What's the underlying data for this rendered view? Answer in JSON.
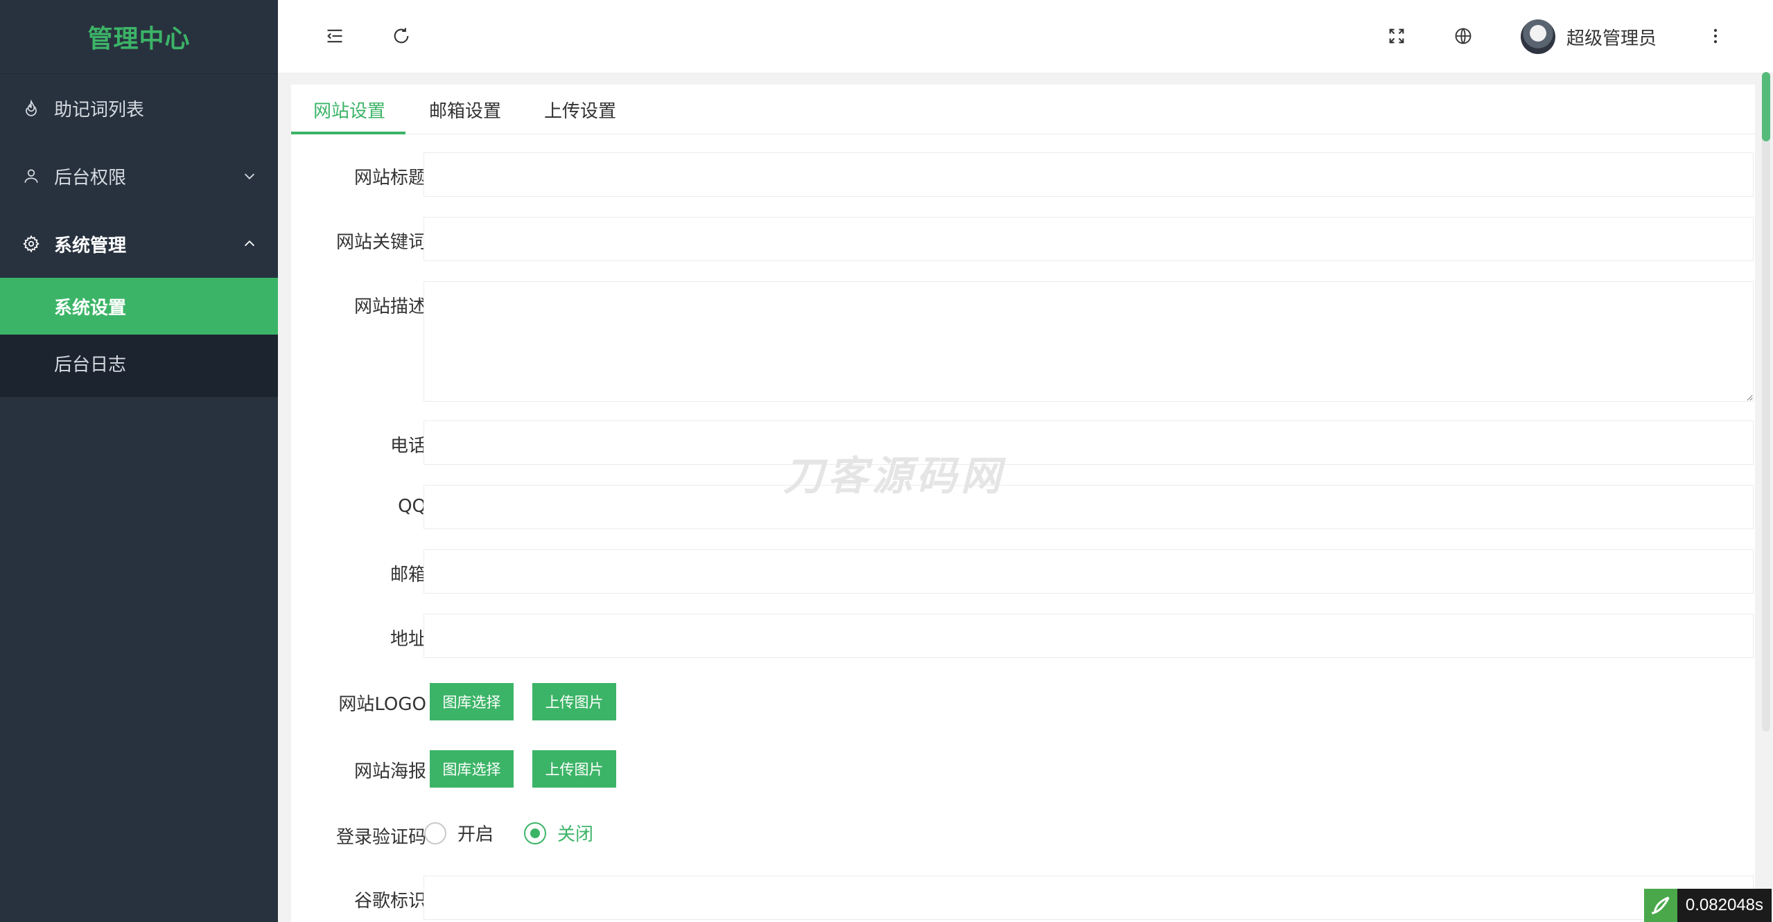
{
  "sidebar": {
    "brand": "管理中心",
    "items": [
      {
        "label": "助记词列表",
        "icon": "fire-icon"
      },
      {
        "label": "后台权限",
        "icon": "user-icon"
      },
      {
        "label": "系统管理",
        "icon": "gear-icon"
      }
    ],
    "submenu": [
      {
        "label": "系统设置",
        "active": true
      },
      {
        "label": "后台日志",
        "active": false
      }
    ]
  },
  "header": {
    "user_name": "超级管理员",
    "icons": [
      "menu-fold-icon",
      "refresh-icon",
      "fullscreen-icon",
      "globe-icon",
      "more-vertical-icon"
    ]
  },
  "tabs": [
    {
      "label": "网站设置",
      "active": true
    },
    {
      "label": "邮箱设置",
      "active": false
    },
    {
      "label": "上传设置",
      "active": false
    }
  ],
  "form": {
    "site_title": {
      "label": "网站标题",
      "value": ""
    },
    "site_keywords": {
      "label": "网站关键词",
      "value": ""
    },
    "site_description": {
      "label": "网站描述",
      "value": ""
    },
    "phone": {
      "label": "电话",
      "value": ""
    },
    "qq": {
      "label": "QQ",
      "value": ""
    },
    "email": {
      "label": "邮箱",
      "value": ""
    },
    "address": {
      "label": "地址",
      "value": ""
    },
    "logo": {
      "label": "网站LOGO",
      "gallery_btn": "图库选择",
      "upload_btn": "上传图片"
    },
    "poster": {
      "label": "网站海报",
      "gallery_btn": "图库选择",
      "upload_btn": "上传图片"
    },
    "captcha": {
      "label": "登录验证码",
      "options": [
        "开启",
        "关闭"
      ],
      "selected": "关闭"
    },
    "google": {
      "label": "谷歌标识",
      "value": ""
    }
  },
  "watermark": "刀客源码网",
  "timer": "0.082048s",
  "colors": {
    "accent": "#3cb467",
    "sidebar_bg": "#28323f",
    "submenu_bg": "#1c2430"
  }
}
